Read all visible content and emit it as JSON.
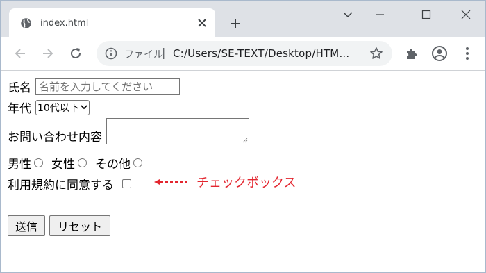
{
  "browser": {
    "tab_title": "index.html",
    "new_tab_symbol": "+",
    "omnibox": {
      "security_chip": "ファイル",
      "separator": "|",
      "url": "C:/Users/SE-TEXT/Desktop/HTM..."
    }
  },
  "form": {
    "name_label": "氏名",
    "name_placeholder": "名前を入力してください",
    "age_label": "年代",
    "age_selected": "10代以下",
    "inquiry_label": "お問い合わせ内容",
    "gender_options": [
      "男性",
      "女性",
      "その他"
    ],
    "terms_label": "利用規約に同意する",
    "submit_label": "送信",
    "reset_label": "リセット"
  },
  "annotation": {
    "label": "チェックボックス",
    "color": "#e3262f"
  },
  "colors": {
    "tabstrip": "#dee1e6",
    "omnibox": "#f1f3f4",
    "window_border": "#a9b9cc"
  }
}
